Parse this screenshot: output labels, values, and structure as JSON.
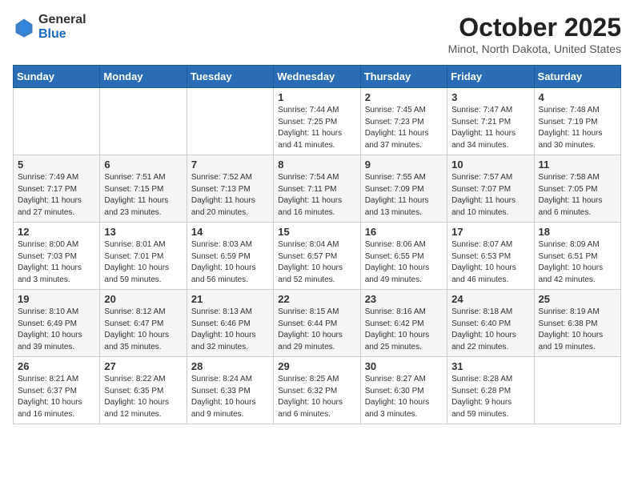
{
  "header": {
    "logo_general": "General",
    "logo_blue": "Blue",
    "month_title": "October 2025",
    "subtitle": "Minot, North Dakota, United States"
  },
  "days_of_week": [
    "Sunday",
    "Monday",
    "Tuesday",
    "Wednesday",
    "Thursday",
    "Friday",
    "Saturday"
  ],
  "weeks": [
    [
      {
        "day": "",
        "sunrise": "",
        "sunset": "",
        "daylight": ""
      },
      {
        "day": "",
        "sunrise": "",
        "sunset": "",
        "daylight": ""
      },
      {
        "day": "",
        "sunrise": "",
        "sunset": "",
        "daylight": ""
      },
      {
        "day": "1",
        "sunrise": "Sunrise: 7:44 AM",
        "sunset": "Sunset: 7:25 PM",
        "daylight": "Daylight: 11 hours and 41 minutes."
      },
      {
        "day": "2",
        "sunrise": "Sunrise: 7:45 AM",
        "sunset": "Sunset: 7:23 PM",
        "daylight": "Daylight: 11 hours and 37 minutes."
      },
      {
        "day": "3",
        "sunrise": "Sunrise: 7:47 AM",
        "sunset": "Sunset: 7:21 PM",
        "daylight": "Daylight: 11 hours and 34 minutes."
      },
      {
        "day": "4",
        "sunrise": "Sunrise: 7:48 AM",
        "sunset": "Sunset: 7:19 PM",
        "daylight": "Daylight: 11 hours and 30 minutes."
      }
    ],
    [
      {
        "day": "5",
        "sunrise": "Sunrise: 7:49 AM",
        "sunset": "Sunset: 7:17 PM",
        "daylight": "Daylight: 11 hours and 27 minutes."
      },
      {
        "day": "6",
        "sunrise": "Sunrise: 7:51 AM",
        "sunset": "Sunset: 7:15 PM",
        "daylight": "Daylight: 11 hours and 23 minutes."
      },
      {
        "day": "7",
        "sunrise": "Sunrise: 7:52 AM",
        "sunset": "Sunset: 7:13 PM",
        "daylight": "Daylight: 11 hours and 20 minutes."
      },
      {
        "day": "8",
        "sunrise": "Sunrise: 7:54 AM",
        "sunset": "Sunset: 7:11 PM",
        "daylight": "Daylight: 11 hours and 16 minutes."
      },
      {
        "day": "9",
        "sunrise": "Sunrise: 7:55 AM",
        "sunset": "Sunset: 7:09 PM",
        "daylight": "Daylight: 11 hours and 13 minutes."
      },
      {
        "day": "10",
        "sunrise": "Sunrise: 7:57 AM",
        "sunset": "Sunset: 7:07 PM",
        "daylight": "Daylight: 11 hours and 10 minutes."
      },
      {
        "day": "11",
        "sunrise": "Sunrise: 7:58 AM",
        "sunset": "Sunset: 7:05 PM",
        "daylight": "Daylight: 11 hours and 6 minutes."
      }
    ],
    [
      {
        "day": "12",
        "sunrise": "Sunrise: 8:00 AM",
        "sunset": "Sunset: 7:03 PM",
        "daylight": "Daylight: 11 hours and 3 minutes."
      },
      {
        "day": "13",
        "sunrise": "Sunrise: 8:01 AM",
        "sunset": "Sunset: 7:01 PM",
        "daylight": "Daylight: 10 hours and 59 minutes."
      },
      {
        "day": "14",
        "sunrise": "Sunrise: 8:03 AM",
        "sunset": "Sunset: 6:59 PM",
        "daylight": "Daylight: 10 hours and 56 minutes."
      },
      {
        "day": "15",
        "sunrise": "Sunrise: 8:04 AM",
        "sunset": "Sunset: 6:57 PM",
        "daylight": "Daylight: 10 hours and 52 minutes."
      },
      {
        "day": "16",
        "sunrise": "Sunrise: 8:06 AM",
        "sunset": "Sunset: 6:55 PM",
        "daylight": "Daylight: 10 hours and 49 minutes."
      },
      {
        "day": "17",
        "sunrise": "Sunrise: 8:07 AM",
        "sunset": "Sunset: 6:53 PM",
        "daylight": "Daylight: 10 hours and 46 minutes."
      },
      {
        "day": "18",
        "sunrise": "Sunrise: 8:09 AM",
        "sunset": "Sunset: 6:51 PM",
        "daylight": "Daylight: 10 hours and 42 minutes."
      }
    ],
    [
      {
        "day": "19",
        "sunrise": "Sunrise: 8:10 AM",
        "sunset": "Sunset: 6:49 PM",
        "daylight": "Daylight: 10 hours and 39 minutes."
      },
      {
        "day": "20",
        "sunrise": "Sunrise: 8:12 AM",
        "sunset": "Sunset: 6:47 PM",
        "daylight": "Daylight: 10 hours and 35 minutes."
      },
      {
        "day": "21",
        "sunrise": "Sunrise: 8:13 AM",
        "sunset": "Sunset: 6:46 PM",
        "daylight": "Daylight: 10 hours and 32 minutes."
      },
      {
        "day": "22",
        "sunrise": "Sunrise: 8:15 AM",
        "sunset": "Sunset: 6:44 PM",
        "daylight": "Daylight: 10 hours and 29 minutes."
      },
      {
        "day": "23",
        "sunrise": "Sunrise: 8:16 AM",
        "sunset": "Sunset: 6:42 PM",
        "daylight": "Daylight: 10 hours and 25 minutes."
      },
      {
        "day": "24",
        "sunrise": "Sunrise: 8:18 AM",
        "sunset": "Sunset: 6:40 PM",
        "daylight": "Daylight: 10 hours and 22 minutes."
      },
      {
        "day": "25",
        "sunrise": "Sunrise: 8:19 AM",
        "sunset": "Sunset: 6:38 PM",
        "daylight": "Daylight: 10 hours and 19 minutes."
      }
    ],
    [
      {
        "day": "26",
        "sunrise": "Sunrise: 8:21 AM",
        "sunset": "Sunset: 6:37 PM",
        "daylight": "Daylight: 10 hours and 16 minutes."
      },
      {
        "day": "27",
        "sunrise": "Sunrise: 8:22 AM",
        "sunset": "Sunset: 6:35 PM",
        "daylight": "Daylight: 10 hours and 12 minutes."
      },
      {
        "day": "28",
        "sunrise": "Sunrise: 8:24 AM",
        "sunset": "Sunset: 6:33 PM",
        "daylight": "Daylight: 10 hours and 9 minutes."
      },
      {
        "day": "29",
        "sunrise": "Sunrise: 8:25 AM",
        "sunset": "Sunset: 6:32 PM",
        "daylight": "Daylight: 10 hours and 6 minutes."
      },
      {
        "day": "30",
        "sunrise": "Sunrise: 8:27 AM",
        "sunset": "Sunset: 6:30 PM",
        "daylight": "Daylight: 10 hours and 3 minutes."
      },
      {
        "day": "31",
        "sunrise": "Sunrise: 8:28 AM",
        "sunset": "Sunset: 6:28 PM",
        "daylight": "Daylight: 9 hours and 59 minutes."
      },
      {
        "day": "",
        "sunrise": "",
        "sunset": "",
        "daylight": ""
      }
    ]
  ]
}
